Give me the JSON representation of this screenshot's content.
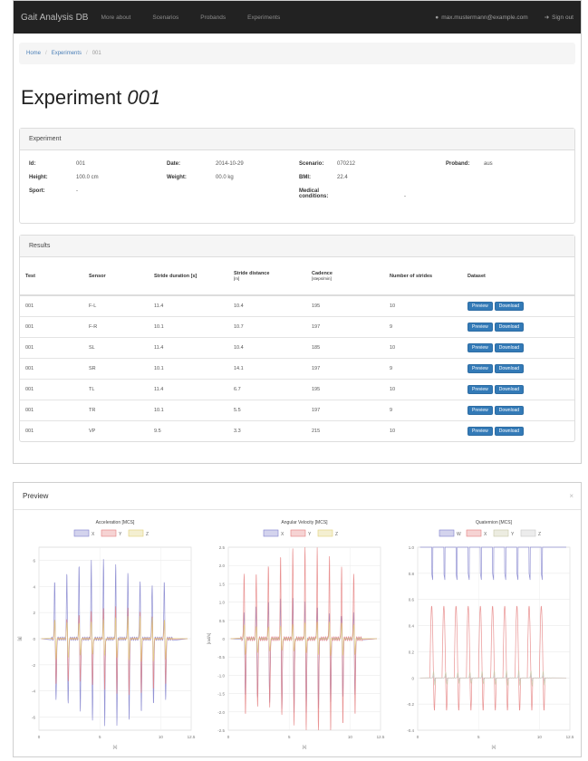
{
  "nav": {
    "brand": "Gait Analysis DB",
    "links": [
      "More about",
      "Scenarios",
      "Probands",
      "Experiments"
    ],
    "user_email": "max.mustermann@example.com",
    "sign_out": "Sign out"
  },
  "breadcrumb": [
    "Home",
    "Experiments",
    "001"
  ],
  "title": {
    "prefix": "Experiment",
    "id": "001"
  },
  "experiment": {
    "heading": "Experiment",
    "fields": {
      "id_label": "Id:",
      "id_value": "001",
      "date_label": "Date:",
      "date_value": "2014-10-29",
      "scenario_label": "Scenario:",
      "scenario_value": "070212",
      "proband_label": "Proband:",
      "proband_value": "aus",
      "height_label": "Height:",
      "height_value": "100.0 cm",
      "weight_label": "Weight:",
      "weight_value": "00.0 kg",
      "bmi_label": "BMI:",
      "bmi_value": "22.4",
      "sport_label": "Sport:",
      "sport_value": "-",
      "medical_label": "Medical conditions:",
      "medical_value": "-"
    }
  },
  "results": {
    "heading": "Results",
    "columns": [
      "Test",
      "Sensor",
      "Stride duration [s]",
      "Stride distance",
      "Cadence",
      "Number of strides",
      "Dataset"
    ],
    "column_units": [
      "",
      "",
      "",
      "[m]",
      "[steps/min]",
      "",
      ""
    ],
    "preview_label": "Preview",
    "download_label": "Download",
    "rows": [
      [
        "001",
        "F-L",
        "11.4",
        "10.4",
        "195",
        "10"
      ],
      [
        "001",
        "F-R",
        "10.1",
        "10.7",
        "197",
        "9"
      ],
      [
        "001",
        "SL",
        "11.4",
        "10.4",
        "185",
        "10"
      ],
      [
        "001",
        "SR",
        "10.1",
        "14.1",
        "197",
        "9"
      ],
      [
        "001",
        "TL",
        "11.4",
        "6.7",
        "195",
        "10"
      ],
      [
        "001",
        "TR",
        "10.1",
        "5.5",
        "197",
        "9"
      ],
      [
        "001",
        "VP",
        "9.5",
        "3.3",
        "215",
        "10"
      ]
    ]
  },
  "modal": {
    "title": "Preview",
    "close": "×"
  },
  "colors": {
    "x": "#8080cc",
    "y": "#e58080",
    "z": "#e0d07a",
    "w": "#9a9ad0",
    "navbar": "#222222",
    "btn": "#337ab7"
  },
  "chart_data": [
    {
      "type": "line",
      "title": "Acceleration [MCS]",
      "xlabel": "[s]",
      "ylabel": "[g]",
      "xlim": [
        0,
        12.5
      ],
      "ylim": [
        -7,
        7
      ],
      "xticks": [
        "0",
        "5",
        "10",
        "12.5"
      ],
      "yticks": [
        "6",
        "4",
        "2",
        "0",
        "-2",
        "-4",
        "-6"
      ],
      "series": [
        {
          "name": "X",
          "color": "#8080cc",
          "peaks": [
            5.2,
            -5.8
          ]
        },
        {
          "name": "Y",
          "color": "#e58080",
          "peaks": [
            2.0,
            -3.8
          ]
        },
        {
          "name": "Z",
          "color": "#e0d07a",
          "peaks": [
            1.5,
            -1.5
          ]
        }
      ]
    },
    {
      "type": "line",
      "title": "Angular Velocity [MCS]",
      "xlabel": "[s]",
      "ylabel": "[rad/s]",
      "xlim": [
        0,
        12.5
      ],
      "ylim": [
        -2.5,
        2.5
      ],
      "xticks": [
        "0",
        "5",
        "10",
        "12.5"
      ],
      "yticks": [
        "2.5",
        "2.0",
        "1.5",
        "1.0",
        "0.5",
        "0",
        "-0.5",
        "-1.0",
        "-1.5",
        "-2.0",
        "-2.5"
      ],
      "series": [
        {
          "name": "X",
          "color": "#8080cc",
          "peaks": [
            0.9,
            -1.8
          ]
        },
        {
          "name": "Y",
          "color": "#e58080",
          "peaks": [
            2.2,
            -2.3
          ]
        },
        {
          "name": "Z",
          "color": "#e0d07a",
          "peaks": [
            0.4,
            -0.4
          ]
        }
      ]
    },
    {
      "type": "line",
      "title": "Quaternion [MCS]",
      "xlabel": "[s]",
      "ylabel": "",
      "xlim": [
        0,
        12.5
      ],
      "ylim": [
        -0.4,
        1.0
      ],
      "xticks": [
        "0",
        "5",
        "10",
        "12.5"
      ],
      "yticks": [
        "1.0",
        "0.8",
        "0.6",
        "0.4",
        "0.2",
        "0",
        "-0.2",
        "-0.4"
      ],
      "series": [
        {
          "name": "W",
          "color": "#8080cc",
          "peaks": [
            1.0,
            0.8
          ]
        },
        {
          "name": "X",
          "color": "#e58080",
          "peaks": [
            0.55,
            -0.25
          ]
        },
        {
          "name": "Y",
          "color": "#c8c8a8",
          "peaks": [
            0.05,
            -0.05
          ]
        },
        {
          "name": "Z",
          "color": "#c8c8c8",
          "peaks": [
            0.02,
            -0.02
          ]
        }
      ]
    }
  ]
}
